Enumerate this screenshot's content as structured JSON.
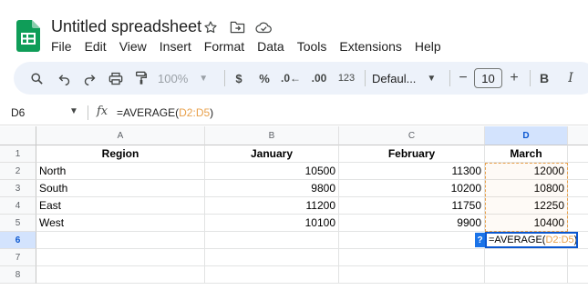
{
  "app": {
    "title": "Untitled spreadsheet",
    "menu": [
      "File",
      "Edit",
      "View",
      "Insert",
      "Format",
      "Data",
      "Tools",
      "Extensions",
      "Help"
    ]
  },
  "toolbar": {
    "zoom": "100%",
    "currency": "$",
    "percent": "%",
    "decrease_decimal": ".0←",
    "increase_decimal": ".00",
    "more_formats": "123",
    "font_family": "Defaul...",
    "font_size": "10",
    "minus": "−",
    "plus": "+",
    "bold": "B",
    "italic": "I"
  },
  "formula_bar": {
    "name_box": "D6",
    "fx": "fx",
    "formula_prefix": "=AVERAGE(",
    "formula_range": "D2:D5",
    "formula_suffix": ")"
  },
  "grid": {
    "columns": [
      "A",
      "B",
      "C",
      "D"
    ],
    "rows": [
      "1",
      "2",
      "3",
      "4",
      "5",
      "6",
      "7",
      "8"
    ],
    "headers": [
      "Region",
      "January",
      "February",
      "March"
    ],
    "data": [
      [
        "North",
        "10500",
        "11300",
        "12000"
      ],
      [
        "South",
        "9800",
        "10200",
        "10800"
      ],
      [
        "East",
        "11200",
        "11750",
        "12250"
      ],
      [
        "West",
        "10100",
        "9900",
        "10400"
      ]
    ],
    "selected_column": "D",
    "selected_row": "6",
    "edit_help": "?",
    "edit_prefix": "=AVERAGE(",
    "edit_range": "D2:D5",
    "edit_suffix": ")"
  },
  "colors": {
    "selection": "#0b57d0",
    "range_highlight": "#e8a14c",
    "toolbar_bg": "#edf2fa",
    "logo_green": "#0f9d58"
  }
}
